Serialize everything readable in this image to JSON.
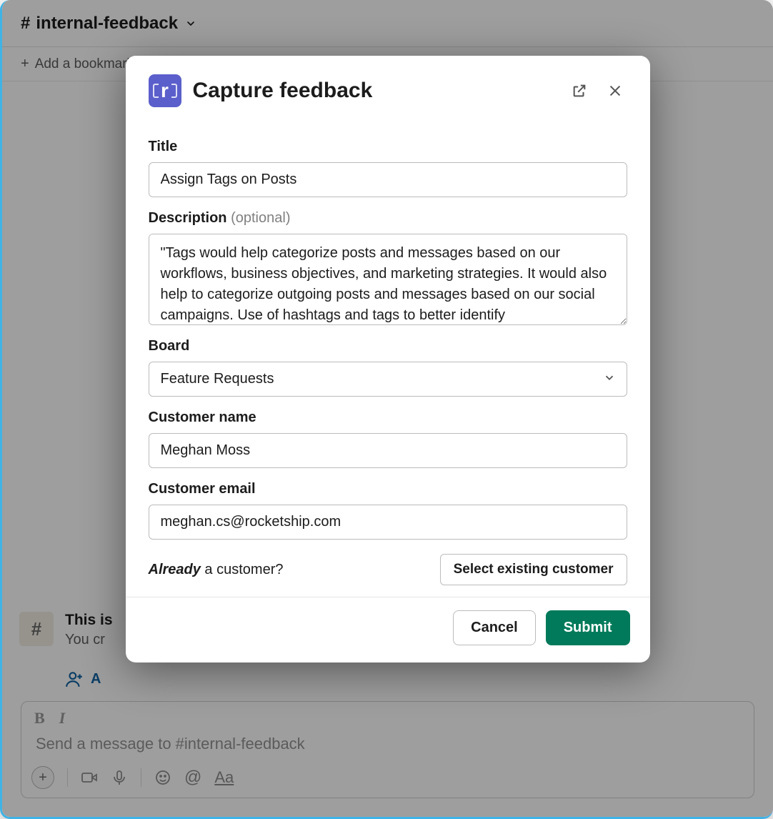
{
  "colors": {
    "accent_green": "#007a5a",
    "logo_bg": "#5b5fcb",
    "slack_blue": "#1264a3"
  },
  "channel": {
    "hash": "#",
    "name": "internal-feedback",
    "bookmark_prompt": "Add a bookmark",
    "intro_line1": "This is",
    "intro_line2": "You cr",
    "add_people_label": "A"
  },
  "composer": {
    "bold": "B",
    "italic": "I",
    "placeholder": "Send a message to #internal-feedback",
    "at": "@",
    "aa": "Aa"
  },
  "modal": {
    "logo_letter": "r",
    "title": "Capture feedback",
    "fields": {
      "title": {
        "label": "Title",
        "value": "Assign Tags on Posts"
      },
      "description": {
        "label": "Description",
        "optional": "(optional)",
        "value": "\"Tags would help categorize posts and messages based on our workflows, business objectives, and marketing strategies. It would also help to categorize outgoing posts and messages based on our social campaigns. Use of hashtags and tags to better identify"
      },
      "board": {
        "label": "Board",
        "value": "Feature Requests"
      },
      "customer_name": {
        "label": "Customer name",
        "value": "Meghan Moss"
      },
      "customer_email": {
        "label": "Customer email",
        "value": "meghan.cs@rocketship.com"
      }
    },
    "already": {
      "em": "Already",
      "rest": " a customer?",
      "button": "Select existing customer"
    },
    "footer": {
      "cancel": "Cancel",
      "submit": "Submit"
    }
  }
}
